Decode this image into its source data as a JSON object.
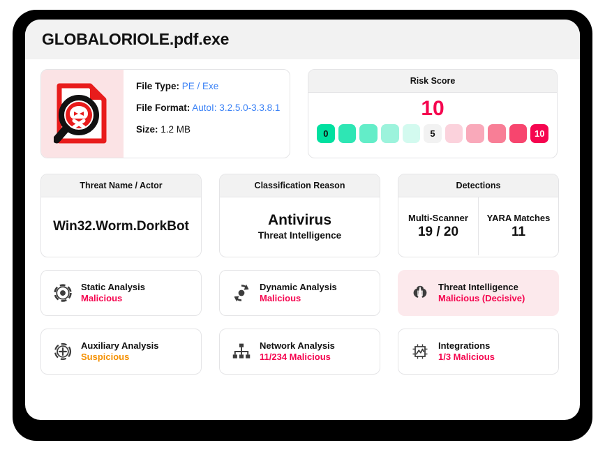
{
  "window": {
    "title": "GLOBALORIOLE.pdf.exe"
  },
  "file_info": {
    "icon": "malware-file-icon",
    "file_type_label": "File Type:",
    "file_type_value": "PE / Exe",
    "file_format_label": "File Format:",
    "file_format_value": "AutoI: 3.2.5.0-3.3.8.1",
    "size_label": "Size:",
    "size_value": "1.2 MB"
  },
  "risk_score": {
    "title": "Risk Score",
    "value": "10",
    "min_label": "0",
    "mid_label": "5",
    "max_label": "10",
    "scale": [
      {
        "label": "0",
        "color": "#00e0a0",
        "text_color": "#111111"
      },
      {
        "label": "",
        "color": "#2ee6b4",
        "text_color": "#111111"
      },
      {
        "label": "",
        "color": "#63edc8",
        "text_color": "#111111"
      },
      {
        "label": "",
        "color": "#9cf3dc",
        "text_color": "#111111"
      },
      {
        "label": "",
        "color": "#d3faef",
        "text_color": "#111111"
      },
      {
        "label": "5",
        "color": "#f2f2f2",
        "text_color": "#111111"
      },
      {
        "label": "",
        "color": "#fbd2dc",
        "text_color": "#111111"
      },
      {
        "label": "",
        "color": "#f9a9ba",
        "text_color": "#111111"
      },
      {
        "label": "",
        "color": "#f87e96",
        "text_color": "#111111"
      },
      {
        "label": "",
        "color": "#f7456e",
        "text_color": "#111111"
      },
      {
        "label": "10",
        "color": "#f5054f",
        "text_color": "#ffffff"
      }
    ]
  },
  "threat_name": {
    "title": "Threat Name / Actor",
    "value": "Win32.Worm.DorkBot"
  },
  "classification": {
    "title": "Classification Reason",
    "value": "Antivirus",
    "subvalue": "Threat Intelligence"
  },
  "detections": {
    "title": "Detections",
    "columns": [
      {
        "label": "Multi-Scanner",
        "value": "19 / 20"
      },
      {
        "label": "YARA Matches",
        "value": "11"
      }
    ]
  },
  "verdict_tiles": [
    {
      "icon": "static-analysis-icon",
      "title": "Static Analysis",
      "status": "Malicious",
      "status_kind": "malicious",
      "highlighted": false
    },
    {
      "icon": "dynamic-analysis-icon",
      "title": "Dynamic Analysis",
      "status": "Malicious",
      "status_kind": "malicious",
      "highlighted": false
    },
    {
      "icon": "threat-intelligence-icon",
      "title": "Threat Intelligence",
      "status": "Malicious (Decisive)",
      "status_kind": "malicious",
      "highlighted": true
    },
    {
      "icon": "auxiliary-analysis-icon",
      "title": "Auxiliary Analysis",
      "status": "Suspicious",
      "status_kind": "suspicious",
      "highlighted": false
    },
    {
      "icon": "network-analysis-icon",
      "title": "Network Analysis",
      "status": "11/234 Malicious",
      "status_kind": "malicious",
      "highlighted": false
    },
    {
      "icon": "integrations-icon",
      "title": "Integrations",
      "status": "1/3 Malicious",
      "status_kind": "malicious",
      "highlighted": false
    }
  ],
  "colors": {
    "malicious": "#f5054f",
    "suspicious": "#f59000",
    "link": "#3b82f6",
    "header_bg": "#f2f2f2",
    "highlight_bg": "#fce9ec"
  }
}
